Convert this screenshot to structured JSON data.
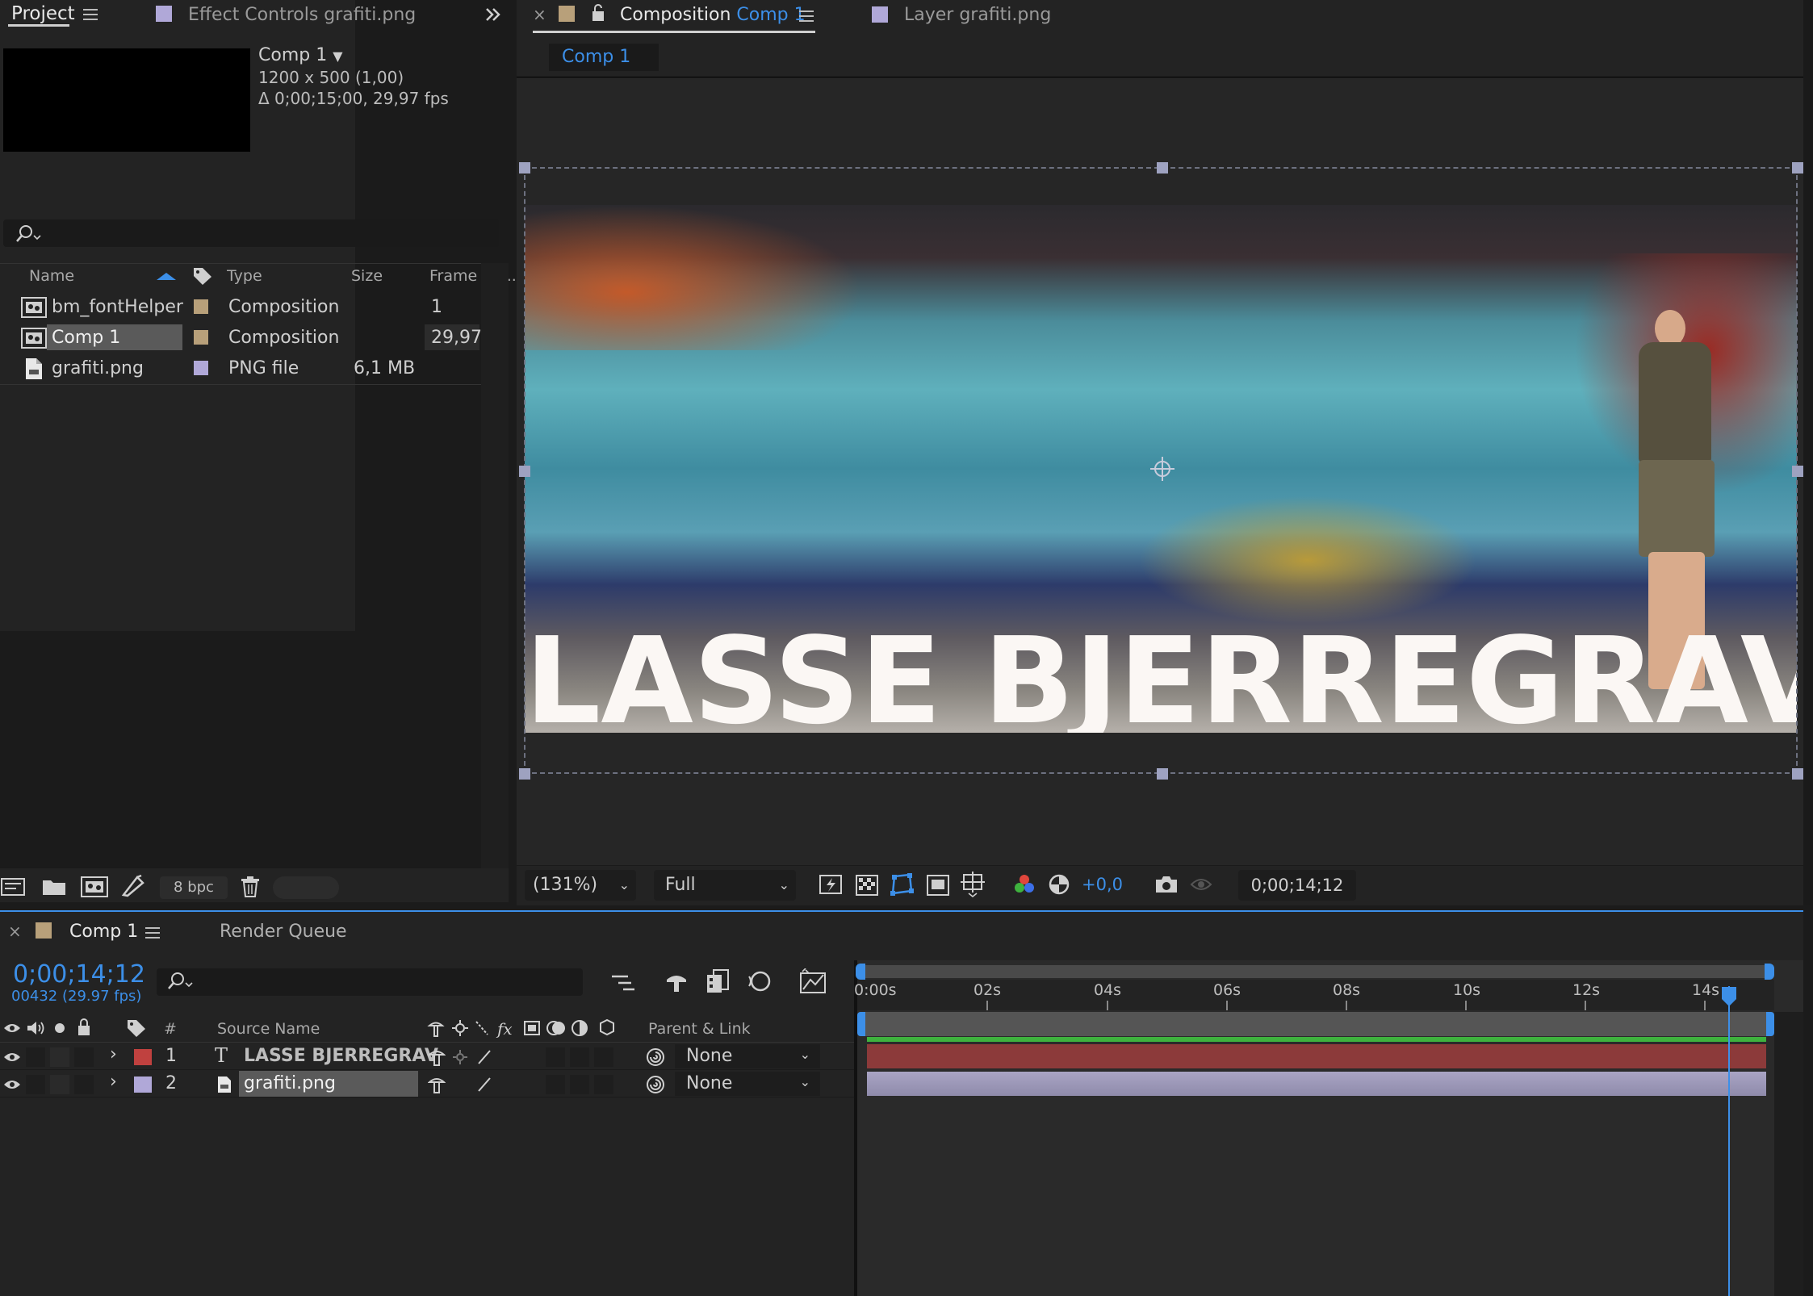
{
  "project_panel": {
    "tab_project": "Project",
    "tab_effect_controls": "Effect Controls grafiti.png",
    "preview": {
      "name": "Comp 1",
      "dims": "1200 x 500 (1,00)",
      "duration": "Δ 0;00;15;00, 29,97 fps"
    },
    "search_placeholder": "",
    "columns": {
      "name": "Name",
      "type": "Type",
      "size": "Size",
      "frame_rate": "Frame Ra..."
    },
    "items": [
      {
        "name": "bm_fontHelper",
        "type": "Composition",
        "size": "",
        "frame_rate": "1",
        "label_color": "#b8a07a"
      },
      {
        "name": "Comp 1",
        "type": "Composition",
        "size": "",
        "frame_rate": "29,97",
        "label_color": "#b8a07a"
      },
      {
        "name": "grafiti.png",
        "type": "PNG file",
        "size": "6,1 MB",
        "frame_rate": "",
        "label_color": "#b0a8d8"
      }
    ],
    "footer": {
      "bpc": "8 bpc"
    }
  },
  "viewer_panel": {
    "tab_composition_prefix": "Composition",
    "tab_composition_name": "Comp 1",
    "tab_layer": "Layer grafiti.png",
    "breadcrumb": "Comp 1",
    "overlay_text": "LASSE BJERREGRAV",
    "toolbar": {
      "zoom": "(131%)",
      "resolution": "Full",
      "exposure": "+0,0",
      "timecode": "0;00;14;12"
    }
  },
  "timeline_panel": {
    "tab_comp": "Comp 1",
    "tab_render_queue": "Render Queue",
    "timecode": "0;00;14;12",
    "frame_info": "00432 (29.97 fps)",
    "columns": {
      "num": "#",
      "source_name": "Source Name",
      "parent_link": "Parent & Link"
    },
    "layers": [
      {
        "num": "1",
        "type_glyph": "T",
        "name": "LASSE BJERREGRAV",
        "parent": "None",
        "label_color": "#c0413f"
      },
      {
        "num": "2",
        "type_glyph": "",
        "name": "grafiti.png",
        "parent": "None",
        "label_color": "#b0a8d8"
      }
    ],
    "ruler_ticks": [
      "0:00s",
      "02s",
      "04s",
      "06s",
      "08s",
      "10s",
      "12s",
      "14s"
    ],
    "playhead_time": "14s"
  },
  "colors": {
    "accent_blue": "#3c8fe8",
    "layer1_bar": "#8c3a3a",
    "layer2_bar": "#9e9ab8",
    "work_area_green": "#3eb23e"
  }
}
